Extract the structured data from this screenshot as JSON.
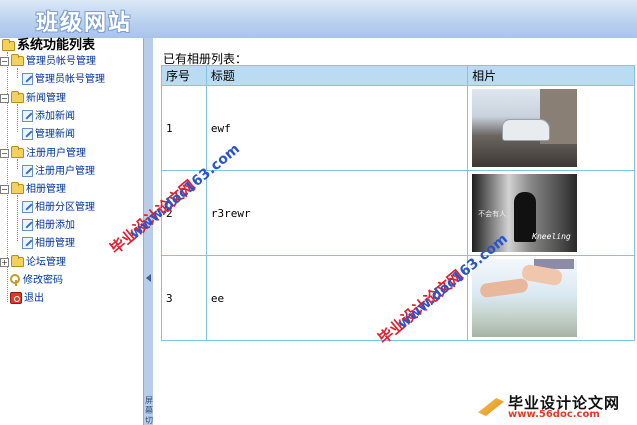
{
  "header": {
    "title": "班级网站"
  },
  "sidebar": {
    "title": "系统功能列表",
    "groups": [
      {
        "label": "管理员帐号管理",
        "items": [
          "管理员帐号管理"
        ]
      },
      {
        "label": "新闻管理",
        "items": [
          "添加新闻",
          "管理新闻"
        ]
      },
      {
        "label": "注册用户管理",
        "items": [
          "注册用户管理"
        ]
      },
      {
        "label": "相册管理",
        "items": [
          "相册分区管理",
          "相册添加",
          "相册管理"
        ]
      },
      {
        "label": "论坛管理",
        "items": []
      }
    ],
    "change_password": "修改密码",
    "logout": "退出"
  },
  "splitter": {
    "label": "屏幕切换"
  },
  "main": {
    "caption": "已有相册列表：",
    "columns": [
      "序号",
      "标题",
      "相片"
    ],
    "rows": [
      {
        "num": "1",
        "title": "ewf",
        "photo": "photo-car"
      },
      {
        "num": "2",
        "title": "r3rewr",
        "photo": "photo-bw-figure"
      },
      {
        "num": "3",
        "title": "ee",
        "photo": "photo-hands"
      }
    ]
  },
  "watermarks": {
    "site_cn": "毕业设计论文网",
    "site_url": "www.doc163.com",
    "footer_cn": "毕业设计论文网",
    "footer_url": "www.56doc.com"
  },
  "thumb_text": {
    "t2_a": "不会有人",
    "t2_b": "Kneeling"
  },
  "colors": {
    "header": "#b9d0ee",
    "table_header": "#b9dcf0",
    "table_border": "#7fc6e4",
    "link": "#003399"
  }
}
